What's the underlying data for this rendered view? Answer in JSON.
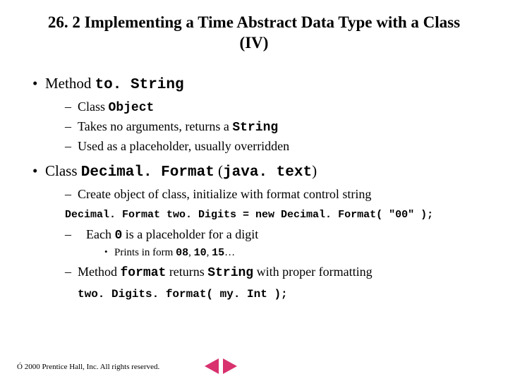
{
  "title": "26. 2   Implementing a Time Abstract Data Type with a Class (IV)",
  "b1": {
    "pre": "Method ",
    "code": "to. String",
    "s1": {
      "pre": "Class ",
      "code": "Object"
    },
    "s2": {
      "pre": "Takes no arguments, returns a ",
      "code": "String"
    },
    "s3": "Used as a placeholder, usually overridden"
  },
  "b2": {
    "pre": "Class ",
    "code1": "Decimal. Format",
    "mid": " (",
    "code2": "java. text",
    "post": ")",
    "s1": "Create object of class, initialize with format control string",
    "codeLine1": "Decimal. Format two. Digits = new Decimal. Format( \"00\" );",
    "s2": {
      "pre": "Each ",
      "code": "0",
      "post": " is a placeholder for a digit"
    },
    "s2a": {
      "pre": "Prints in form ",
      "c1": "08",
      "m1": ", ",
      "c2": "10",
      "m2": ", ",
      "c3": "15",
      "post": "…"
    },
    "s3": {
      "pre": "Method ",
      "c1": "format",
      "mid": " returns ",
      "c2": "String",
      "post": " with proper formatting"
    },
    "codeLine2": "two. Digits. format( my. Int );"
  },
  "footer": "Ó 2000 Prentice Hall, Inc. All rights reserved."
}
